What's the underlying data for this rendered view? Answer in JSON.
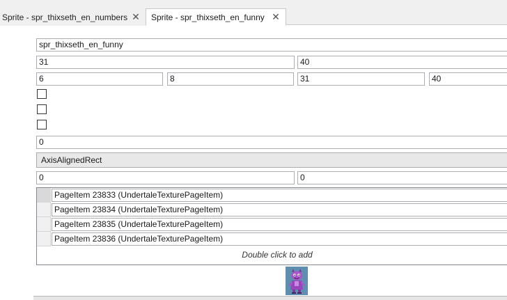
{
  "tabs": [
    {
      "label": "Sprite - spr_thixseth_en_numbers",
      "active": false
    },
    {
      "label": "Sprite - spr_thixseth_en_funny",
      "active": true
    }
  ],
  "sprite": {
    "name": "spr_thixseth_en_funny",
    "width": "31",
    "height": "40",
    "margin_left": "6",
    "margin_top": "8",
    "margin_right": "31",
    "margin_bottom": "40",
    "bbox_mode": "0",
    "sep_masks": "AxisAlignedRect",
    "origin_x": "0",
    "origin_y": "0"
  },
  "checkboxes": [
    {
      "checked": false
    },
    {
      "checked": false
    },
    {
      "checked": false
    }
  ],
  "textures": [
    "PageItem 23833 (UndertaleTexturePageItem)",
    "PageItem 23834 (UndertaleTexturePageItem)",
    "PageItem 23835 (UndertaleTexturePageItem)",
    "PageItem 23836 (UndertaleTexturePageItem)"
  ],
  "grid_hint": "Double click to add",
  "colors": {
    "preview_bg": "#5d8fb0",
    "sprite_purple": "#a855c8"
  }
}
